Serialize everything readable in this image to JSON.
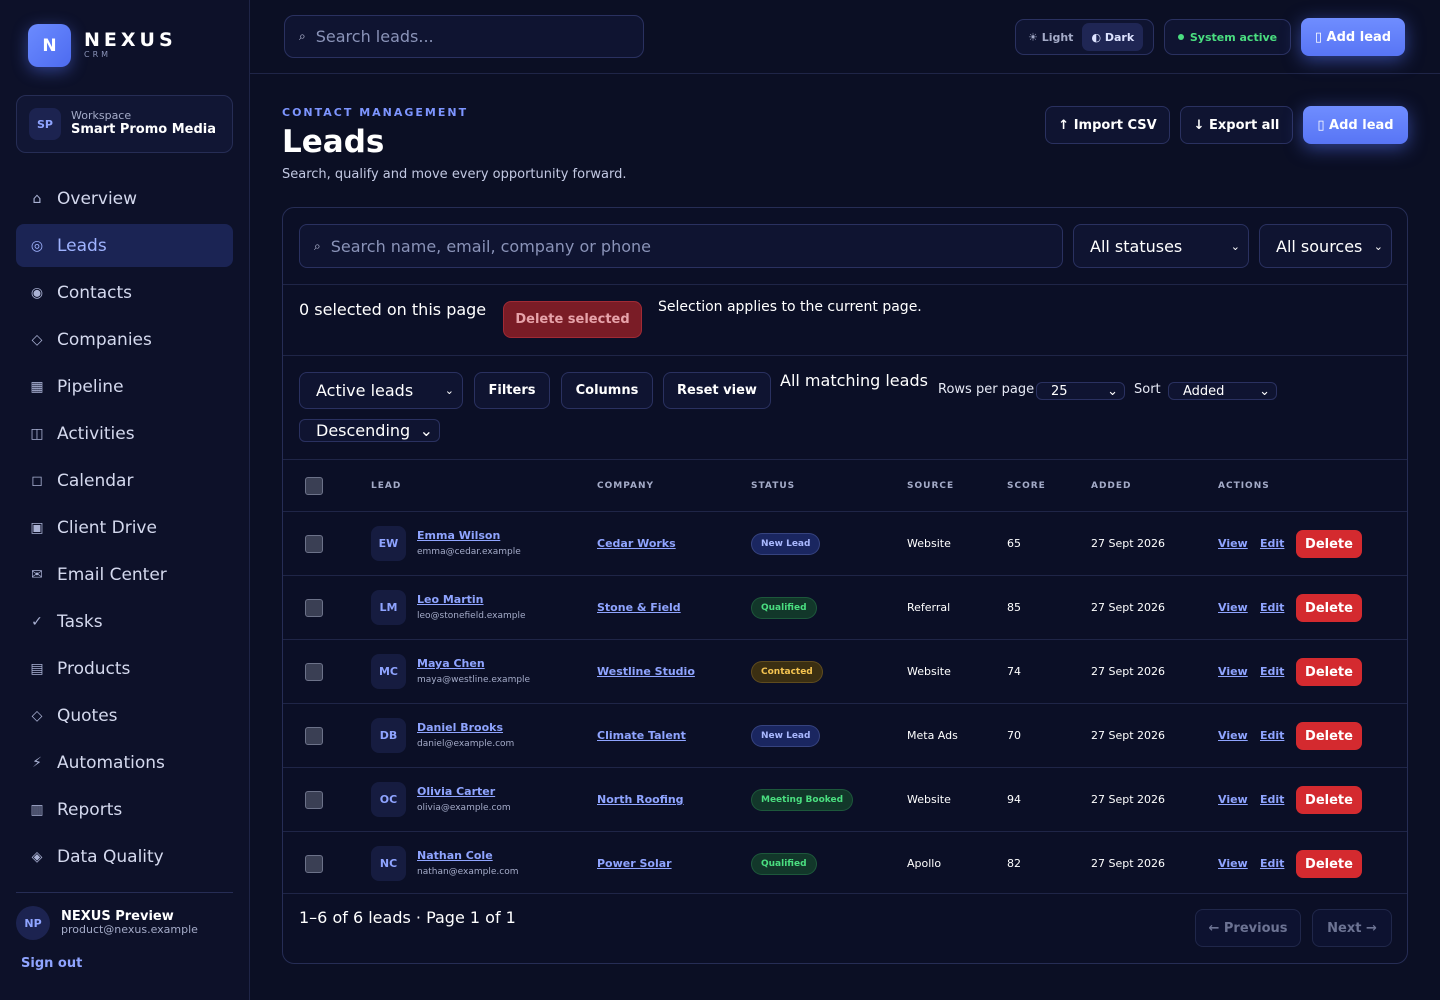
{
  "brand": {
    "logo_letter": "N",
    "name": "NEXUS",
    "sub": "CRM"
  },
  "workspace": {
    "initials": "SP",
    "label": "Workspace",
    "name": "Smart Promo Media"
  },
  "nav": [
    {
      "icon": "⌂",
      "label": "Overview"
    },
    {
      "icon": "◎",
      "label": "Leads"
    },
    {
      "icon": "◉",
      "label": "Contacts"
    },
    {
      "icon": "◇",
      "label": "Companies"
    },
    {
      "icon": "▦",
      "label": "Pipeline"
    },
    {
      "icon": "◫",
      "label": "Activities"
    },
    {
      "icon": "◻",
      "label": "Calendar"
    },
    {
      "icon": "▣",
      "label": "Client Drive"
    },
    {
      "icon": "✉",
      "label": "Email Center"
    },
    {
      "icon": "✓",
      "label": "Tasks"
    },
    {
      "icon": "▤",
      "label": "Products"
    },
    {
      "icon": "◇",
      "label": "Quotes"
    },
    {
      "icon": "⚡",
      "label": "Automations"
    },
    {
      "icon": "▥",
      "label": "Reports"
    },
    {
      "icon": "◈",
      "label": "Data Quality"
    }
  ],
  "user": {
    "initials": "NP",
    "name": "NEXUS Preview",
    "email": "product@nexus.example",
    "signout": "Sign out"
  },
  "topbar": {
    "search_icon": "⌕",
    "search_placeholder": "Search leads...",
    "theme_light": "☀ Light",
    "theme_dark": "◐ Dark",
    "status": "System active",
    "add_lead": "▯ Add lead"
  },
  "header": {
    "eyebrow": "CONTACT MANAGEMENT",
    "title": "Leads",
    "subtitle": "Search, qualify and move every opportunity forward.",
    "import": "↑ Import CSV",
    "export": "↓ Export all",
    "add_lead": "▯ Add lead"
  },
  "filters": {
    "search_icon": "⌕",
    "search_placeholder": "Search name, email, company or phone",
    "status_value": "All statuses",
    "source_value": "All sources",
    "chevron": "⌄"
  },
  "selection": {
    "count": "0 selected on this page",
    "delete": "Delete selected",
    "note": "Selection applies to the current page."
  },
  "toolbar": {
    "view_value": "Active leads",
    "filters": "Filters",
    "columns": "Columns",
    "reset": "Reset view",
    "matching": "All matching leads",
    "rows_label": "Rows per page",
    "rows_value": "25",
    "sort_label": "Sort",
    "sort_value": "Added",
    "order_value": "Descending"
  },
  "table": {
    "headers": {
      "lead": "LEAD",
      "company": "COMPANY",
      "status": "STATUS",
      "source": "SOURCE",
      "score": "SCORE",
      "added": "ADDED",
      "actions": "ACTIONS"
    },
    "view_label": "View",
    "edit_label": "Edit",
    "delete_label": "Delete",
    "rows": [
      {
        "initials": "EW",
        "name": "Emma Wilson",
        "email": "emma@cedar.example",
        "company": "Cedar Works",
        "status": "New Lead",
        "source": "Website",
        "score": "65",
        "added": "27 Sept 2026"
      },
      {
        "initials": "LM",
        "name": "Leo Martin",
        "email": "leo@stonefield.example",
        "company": "Stone & Field",
        "status": "Qualified",
        "source": "Referral",
        "score": "85",
        "added": "27 Sept 2026"
      },
      {
        "initials": "MC",
        "name": "Maya Chen",
        "email": "maya@westline.example",
        "company": "Westline Studio",
        "status": "Contacted",
        "source": "Website",
        "score": "74",
        "added": "27 Sept 2026"
      },
      {
        "initials": "DB",
        "name": "Daniel Brooks",
        "email": "daniel@example.com",
        "company": "Climate Talent",
        "status": "New Lead",
        "source": "Meta Ads",
        "score": "70",
        "added": "27 Sept 2026"
      },
      {
        "initials": "OC",
        "name": "Olivia Carter",
        "email": "olivia@example.com",
        "company": "North Roofing",
        "status": "Meeting Booked",
        "source": "Website",
        "score": "94",
        "added": "27 Sept 2026"
      },
      {
        "initials": "NC",
        "name": "Nathan Cole",
        "email": "nathan@example.com",
        "company": "Power Solar",
        "status": "Qualified",
        "source": "Apollo",
        "score": "82",
        "added": "27 Sept 2026"
      }
    ]
  },
  "pager": {
    "summary": "1–6 of 6 leads · Page 1 of 1",
    "previous": "← Previous",
    "next": "Next →"
  },
  "colors": {
    "accent": "#6f8dff",
    "status_new": {
      "bg": "#1a2660",
      "fg": "#a9b8ff"
    },
    "status_qualified": {
      "bg": "#12372a",
      "fg": "#4ade80"
    },
    "status_contacted": {
      "bg": "#3b2f12",
      "fg": "#f5c451"
    },
    "status_meeting": {
      "bg": "#12372a",
      "fg": "#4ade80"
    }
  }
}
